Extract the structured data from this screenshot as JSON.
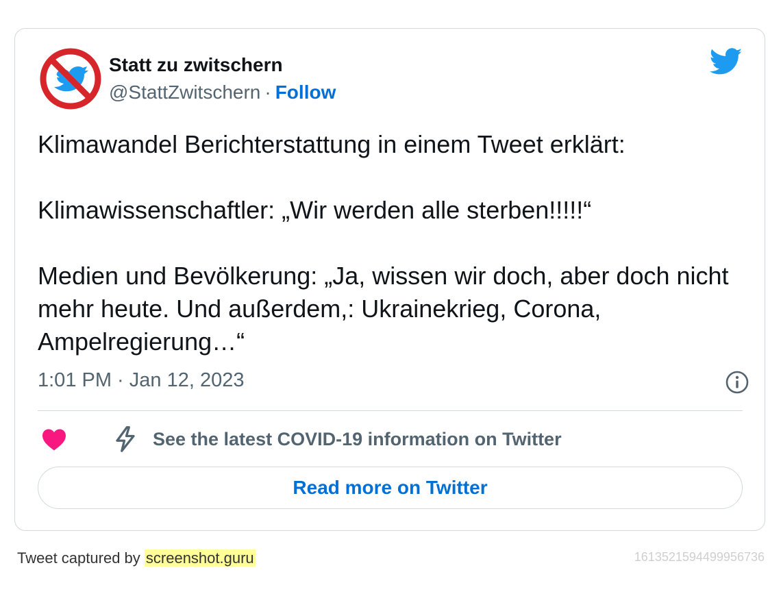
{
  "author": {
    "name": "Statt zu zwitschern",
    "handle": "@StattZwitschern",
    "separator": "·",
    "follow_label": "Follow"
  },
  "tweet": {
    "paragraphs": [
      "Klimawandel Berichterstattung in einem Tweet erklärt:",
      "Klimawissenschaftler: „Wir werden alle sterben!!!!!“",
      "Medien und Bevölkerung: „Ja, wissen wir doch, aber doch nicht mehr heute. Und außerdem,: Ukrainekrieg, Corona, Ampelregierung…“"
    ],
    "timestamp": "1:01 PM · Jan 12, 2023"
  },
  "actions": {
    "covid_info": "See the latest COVID-19 information on Twitter",
    "read_more": "Read more on Twitter"
  },
  "footer": {
    "captured_by": "Tweet captured by ",
    "brand": "screenshot.guru",
    "tweet_id": "1613521594499956736"
  },
  "colors": {
    "link_blue": "#006fd6",
    "twitter_blue": "#1d9bf0",
    "like_pink": "#f91880",
    "muted_text": "#536471",
    "border": "#cfd9de",
    "brand_highlight": "#ffff99"
  },
  "icons": {
    "avatar": "no-twitter-avatar",
    "logo": "twitter-bird-icon",
    "info": "info-icon",
    "like": "heart-icon",
    "covid": "lightning-bolt-icon"
  }
}
